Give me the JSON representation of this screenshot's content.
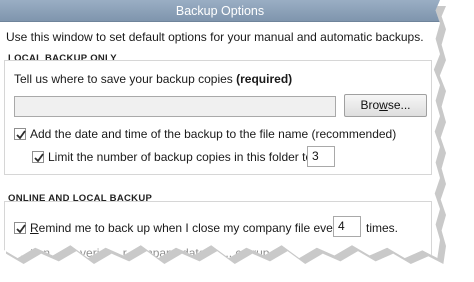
{
  "window": {
    "title": "Backup Options"
  },
  "intro_text": "Use this window to set default options for your manual and automatic backups.",
  "local_backup": {
    "group_label": "LOCAL BACKUP ONLY",
    "prompt": "Tell us where to save your backup copies",
    "prompt_required": "(required)",
    "path_value": "",
    "browse_label_prefix": "Bro",
    "browse_label_underlined": "w",
    "browse_label_suffix": "se...",
    "add_date_time": {
      "label": "Add the date and time of the backup to the file name (recommended)",
      "checked": true
    },
    "limit_copies": {
      "label": "Limit the number of backup copies in this folder to",
      "checked": true,
      "value": "3"
    }
  },
  "online_local_backup": {
    "group_label": "ONLINE AND LOCAL BACKUP",
    "remind": {
      "label_underlined": "R",
      "label_rest": "emind me to back up when I close my company file every",
      "checked": true,
      "value": "4",
      "suffix": "times."
    },
    "partial_text": "...t an ... to veri... ...r company data ... ... corrup..."
  },
  "colors": {
    "titlebar": "#8ea3ba",
    "title_text": "#ffffff"
  }
}
